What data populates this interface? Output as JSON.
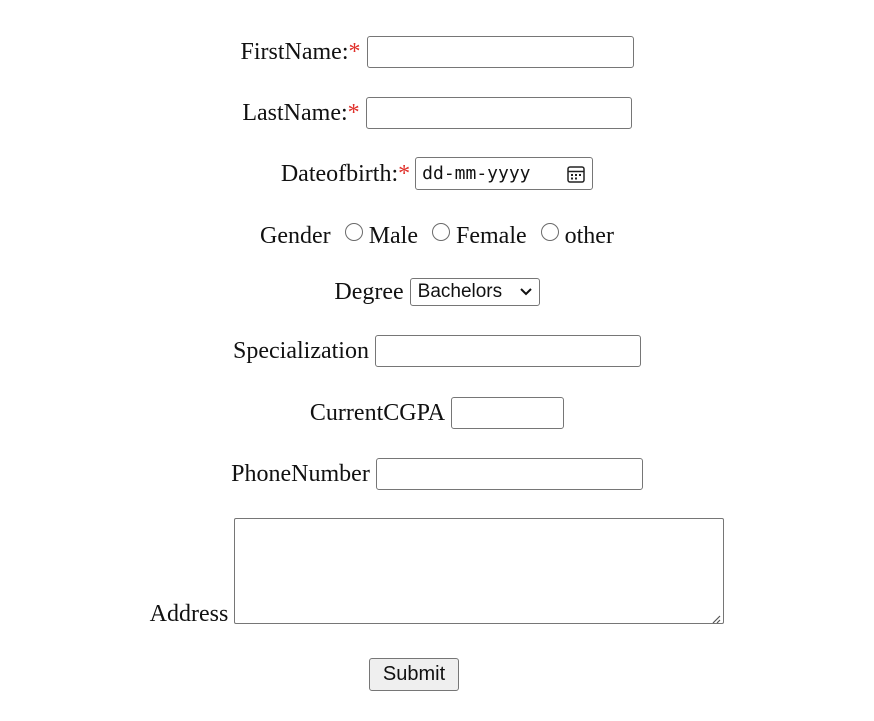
{
  "form": {
    "first_name": {
      "label": "FirstName:",
      "required_mark": "*",
      "value": ""
    },
    "last_name": {
      "label": "LastName:",
      "required_mark": "*",
      "value": ""
    },
    "dob": {
      "label": "Dateofbirth:",
      "required_mark": "*",
      "placeholder": "dd-mm-yyyy",
      "icon": "calendar-icon"
    },
    "gender": {
      "label": "Gender",
      "options": [
        "Male",
        "Female",
        "other"
      ],
      "selected": null
    },
    "degree": {
      "label": "Degree",
      "selected": "Bachelors",
      "icon": "chevron-down-icon"
    },
    "specialization": {
      "label": "Specialization",
      "value": ""
    },
    "cgpa": {
      "label": "CurrentCGPA",
      "value": ""
    },
    "phone": {
      "label": "PhoneNumber",
      "value": ""
    },
    "address": {
      "label": "Address",
      "value": ""
    },
    "submit_label": "Submit"
  },
  "colors": {
    "required": "#e0302a",
    "border": "#767676",
    "button_bg": "#efefef"
  }
}
